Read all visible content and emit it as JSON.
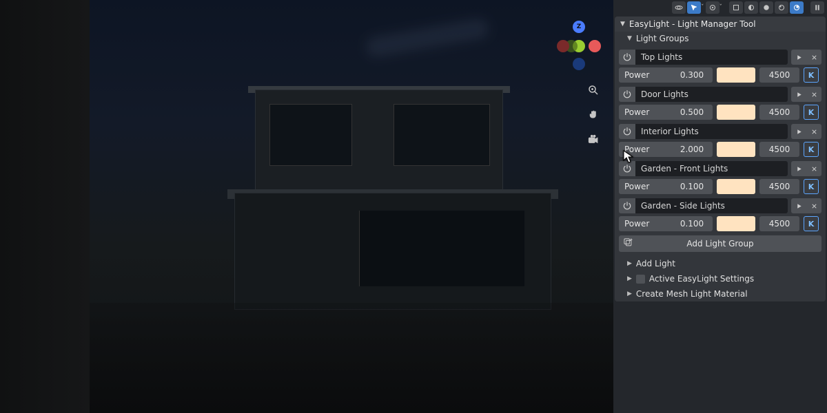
{
  "panel": {
    "title": "EasyLight - Light Manager Tool",
    "light_groups_label": "Light Groups",
    "add_group_label": "Add Light Group",
    "groups": [
      {
        "name": "Top Lights",
        "power": "0.300",
        "temp": "4500",
        "color": "#ffe3c0"
      },
      {
        "name": "Door Lights",
        "power": "0.500",
        "temp": "4500",
        "color": "#ffe3c0"
      },
      {
        "name": "Interior Lights",
        "power": "2.000",
        "temp": "4500",
        "color": "#ffe3c0"
      },
      {
        "name": "Garden - Front Lights",
        "power": "0.100",
        "temp": "4500",
        "color": "#ffe3c0"
      },
      {
        "name": "Garden - Side Lights",
        "power": "0.100",
        "temp": "4500",
        "color": "#ffe3c0"
      }
    ],
    "power_label": "Power",
    "k_label": "K",
    "sections": {
      "add_light": "Add Light",
      "active_settings": "Active EasyLight Settings",
      "create_mesh": "Create Mesh Light Material"
    }
  },
  "gizmo": {
    "z": "Z"
  }
}
